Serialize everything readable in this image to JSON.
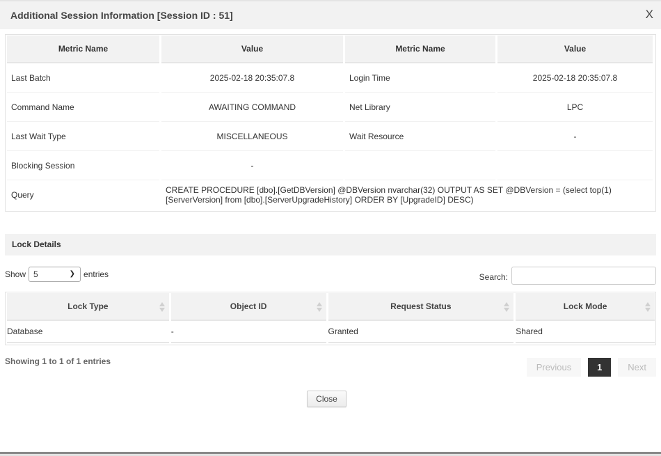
{
  "modal": {
    "title": "Additional Session Information [Session ID : 51]",
    "close_icon_text": "X"
  },
  "metrics": {
    "headers": [
      "Metric Name",
      "Value",
      "Metric Name",
      "Value"
    ],
    "rows": [
      {
        "name1": "Last Batch",
        "value1": "2025-02-18 20:35:07.8",
        "name2": "Login Time",
        "value2": "2025-02-18 20:35:07.8"
      },
      {
        "name1": "Command Name",
        "value1": "AWAITING COMMAND",
        "name2": "Net Library",
        "value2": "LPC"
      },
      {
        "name1": "Last Wait Type",
        "value1": "MISCELLANEOUS",
        "name2": "Wait Resource",
        "value2": "-"
      },
      {
        "name1": "Blocking Session",
        "value1": "-",
        "name2": "",
        "value2": ""
      }
    ],
    "query": {
      "name": "Query",
      "value": "CREATE PROCEDURE [dbo].[GetDBVersion] @DBVersion nvarchar(32) OUTPUT AS SET @DBVersion = (select top(1) [ServerVersion] from [dbo].[ServerUpgradeHistory] ORDER BY [UpgradeID] DESC)"
    }
  },
  "lock_details": {
    "title": "Lock Details",
    "show_label": "Show",
    "entries_label": "entries",
    "page_length": "5",
    "search_label": "Search:",
    "search_value": "",
    "headers": [
      "Lock Type",
      "Object ID",
      "Request Status",
      "Lock Mode"
    ],
    "rows": [
      [
        "Database",
        "-",
        "Granted",
        "Shared"
      ]
    ],
    "info": "Showing 1 to 1 of 1 entries",
    "pagination": {
      "previous": "Previous",
      "current": "1",
      "next": "Next"
    }
  },
  "footer": {
    "close_label": "Close"
  }
}
